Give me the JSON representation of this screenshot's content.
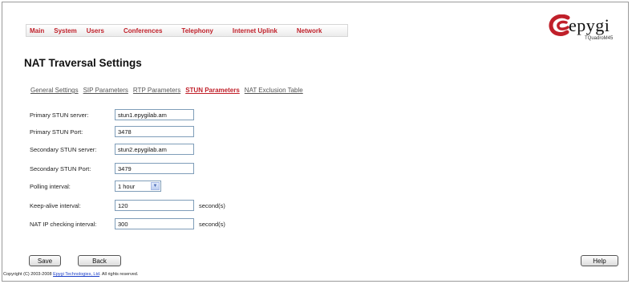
{
  "nav": {
    "items": [
      "Main",
      "System",
      "Users",
      "Conferences",
      "Telephony",
      "Internet Uplink",
      "Network"
    ]
  },
  "logo": {
    "brand": "epygi",
    "model": "TQuadroM45"
  },
  "page": {
    "title": "NAT Traversal Settings"
  },
  "tabs": {
    "items": [
      "General Settings",
      "SIP Parameters",
      "RTP Parameters",
      "STUN Parameters",
      "NAT Exclusion Table"
    ],
    "active": "STUN Parameters"
  },
  "form": {
    "primary_server_label": "Primary STUN server:",
    "primary_server_value": "stun1.epygilab.am",
    "primary_port_label": "Primary STUN Port:",
    "primary_port_value": "3478",
    "secondary_server_label": "Secondary STUN server:",
    "secondary_server_value": "stun2.epygilab.am",
    "secondary_port_label": "Secondary STUN Port:",
    "secondary_port_value": "3479",
    "polling_label": "Polling interval:",
    "polling_value": "1 hour",
    "keepalive_label": "Keep-alive interval:",
    "keepalive_value": "120",
    "keepalive_unit": "second(s)",
    "natip_label": "NAT IP checking interval:",
    "natip_value": "300",
    "natip_unit": "second(s)"
  },
  "buttons": {
    "save": "Save",
    "back": "Back",
    "help": "Help"
  },
  "footer": {
    "prefix": "Copyright (C) 2003-2008 ",
    "company": "Epygi Technologies, Ltd",
    "suffix": ". All rights reserved."
  },
  "colors": {
    "accent": "#c0202a",
    "link": "#555555",
    "input_border": "#7f9db9"
  },
  "icons": {
    "dropdown": "chevron-down-icon",
    "logo": "epygi-swirl-logo"
  }
}
